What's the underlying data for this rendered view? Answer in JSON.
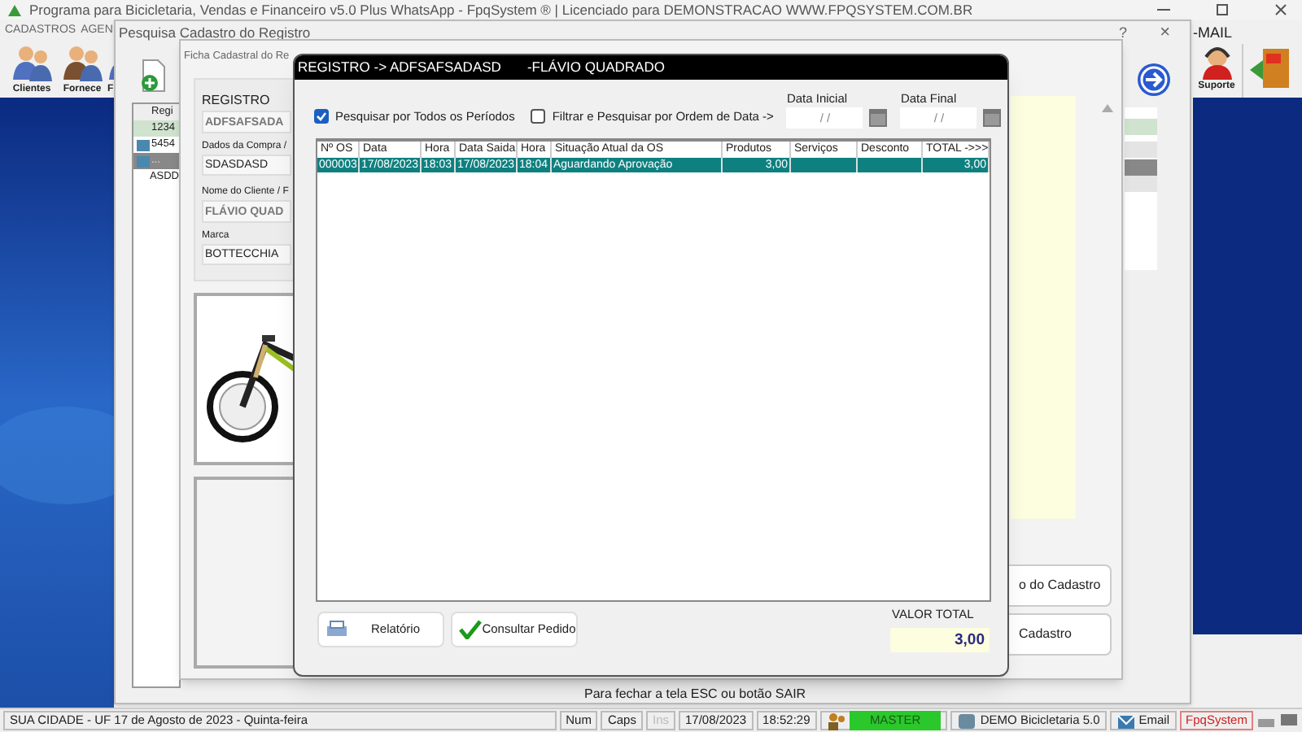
{
  "app_title": "Programa para Bicicletaria, Vendas e Financeiro v5.0 Plus WhatsApp - FpqSystem ® | Licenciado para  DEMONSTRACAO WWW.FPQSYSTEM.COM.BR",
  "menu": [
    "CADASTROS",
    "AGEN",
    "-MAIL"
  ],
  "toolbar_left": [
    {
      "label": "Clientes"
    },
    {
      "label": "Fornece"
    },
    {
      "label": "F"
    }
  ],
  "toolbar_right": [
    {
      "label": "Suporte",
      "kind": "support"
    },
    {
      "kind": "exit"
    }
  ],
  "search_window": {
    "title": "Pesquisa Cadastro do Registro",
    "help": "?",
    "close": "×",
    "list_header": "Regi",
    "list_rows": [
      {
        "text": "1234",
        "selected": false,
        "icon": false
      },
      {
        "text": "5454",
        "selected": false,
        "icon": true
      },
      {
        "text": "...",
        "selected": true,
        "icon": true
      },
      {
        "text": "ASDD",
        "selected": false,
        "icon": false
      }
    ],
    "footer": "Para fechar a tela ESC ou botão SAIR"
  },
  "record_window": {
    "title": "Ficha Cadastral do Re",
    "fields": [
      {
        "label": "REGISTRO",
        "value": "ADFSAFSADA",
        "kind": "big"
      },
      {
        "label": "Dados da Compra /",
        "value": "SDASDASD",
        "kind": "field"
      },
      {
        "label": "Nome do Cliente / F",
        "value": "FLÁVIO QUAD",
        "kind": "big"
      },
      {
        "label": "Marca",
        "value": "BOTTECCHIA",
        "kind": "field"
      }
    ],
    "buttons": [
      "o do Cadastro",
      "Cadastro"
    ]
  },
  "dialog": {
    "title": "REGISTRO -> ADFSAFSADASD",
    "subtitle": "-FLÁVIO QUADRADO",
    "filters": [
      {
        "label": "Pesquisar por Todos os Períodos",
        "checked": true
      },
      {
        "label": "Filtrar e Pesquisar por Ordem de Data ->",
        "checked": false
      }
    ],
    "dates": [
      {
        "label": "Data Inicial",
        "placeholder": "/ /"
      },
      {
        "label": "Data Final",
        "placeholder": "/ /"
      }
    ],
    "table": {
      "columns": [
        "Nº OS",
        "Data",
        "Hora",
        "Data Saida",
        "Hora",
        "Situação Atual da OS",
        "Produtos",
        "Serviços",
        "Desconto",
        "TOTAL ->>>"
      ],
      "rows": [
        {
          "selected": true,
          "cells": [
            "000003",
            "17/08/2023",
            "18:03",
            "17/08/2023",
            "18:04",
            "Aguardando Aprovação",
            "3,00",
            null,
            null,
            "3,00"
          ]
        }
      ]
    },
    "buttons": [
      {
        "label": "Relatório",
        "kind": "print"
      },
      {
        "label": "Consultar Pedido",
        "kind": "check"
      }
    ],
    "total_label": "VALOR TOTAL",
    "total_value": "3,00"
  },
  "status_bar": [
    {
      "text": "SUA CIDADE - UF 17 de Agosto de 2023 - Quinta-feira",
      "kind": "text",
      "disabled": false
    },
    {
      "text": "Num",
      "kind": "text",
      "disabled": false
    },
    {
      "text": "Caps",
      "kind": "text",
      "disabled": false
    },
    {
      "text": "Ins",
      "kind": "text",
      "disabled": true
    },
    {
      "text": "17/08/2023",
      "kind": "text",
      "disabled": false
    },
    {
      "text": "18:52:29",
      "kind": "text",
      "disabled": false
    },
    {
      "text": "MASTER",
      "kind": "user",
      "disabled": false
    },
    {
      "text": "DEMO Bicicletaria 5.0",
      "kind": "db",
      "disabled": false
    },
    {
      "text": "Email",
      "kind": "mail",
      "disabled": false
    },
    {
      "text": "FpqSystem",
      "kind": "brand",
      "disabled": false
    }
  ]
}
